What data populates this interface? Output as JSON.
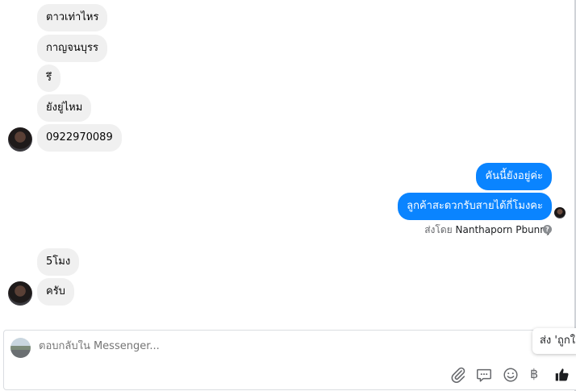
{
  "messages_in_group1": [
    "ตาวเท่าไหร",
    "กาญจนบุรร",
    "รึ",
    "ยังยู่ไหม",
    "0922970089"
  ],
  "messages_out": [
    "คันนี้ยังอยู่ค่ะ",
    "ลูกค้าสะดวกรับสายได้กี่โมงคะ"
  ],
  "sent_by": {
    "prefix": "ส่งโดย",
    "name": "Nanthaporn Pbunny"
  },
  "messages_in_group2": [
    "5โมง",
    "ครับ"
  ],
  "composer": {
    "placeholder": "ตอบกลับใน Messenger...",
    "currency_symbol": "฿"
  },
  "tooltip": {
    "text": "ส่ง 'ถูกใจ'"
  },
  "icons": {
    "attach": "paperclip-icon",
    "reply": "chat-bubble-icon",
    "emoji": "smiley-icon",
    "currency": "baht-icon",
    "like": "thumbs-up-icon",
    "help": "question-icon"
  },
  "colors": {
    "outgoing_bubble": "#0a84ff",
    "incoming_bubble": "#f0f0f0"
  }
}
